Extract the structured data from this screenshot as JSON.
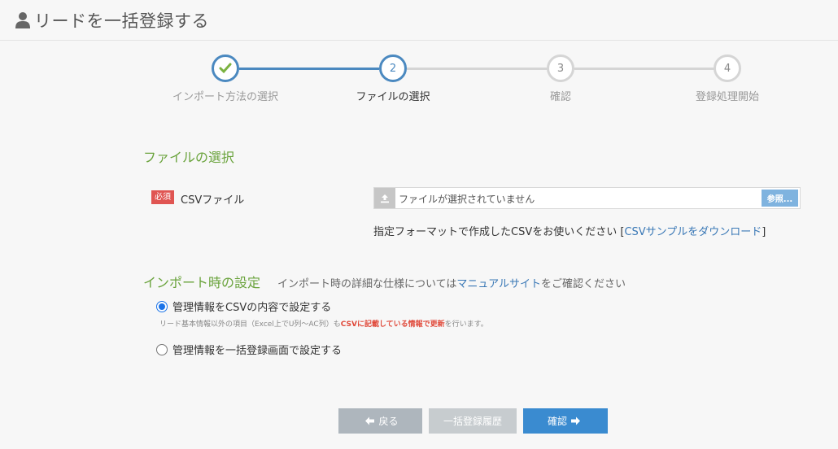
{
  "header": {
    "title": "リードを一括登録する",
    "icon": "user-icon"
  },
  "stepper": {
    "steps": [
      {
        "number": "",
        "label": "インポート方法の選択",
        "state": "done"
      },
      {
        "number": "2",
        "label": "ファイルの選択",
        "state": "active"
      },
      {
        "number": "3",
        "label": "確認",
        "state": "pending"
      },
      {
        "number": "4",
        "label": "登録処理開始",
        "state": "pending"
      }
    ]
  },
  "file_section": {
    "title": "ファイルの選択",
    "required_badge": "必須",
    "csv_label": "CSVファイル",
    "file_placeholder": "ファイルが選択されていません",
    "browse_label": "参照...",
    "note_prefix": "指定フォーマットで作成したCSVをお使いください [",
    "note_link": "CSVサンプルをダウンロード",
    "note_suffix": "]"
  },
  "import_section": {
    "title": "インポート時の設定",
    "hint_prefix": "インポート時の詳細な仕様については",
    "hint_link": "マニュアルサイト",
    "hint_suffix": "をご確認ください",
    "options": [
      {
        "label": "管理情報をCSVの内容で設定する",
        "checked": true
      },
      {
        "label": "管理情報を一括登録画面で設定する",
        "checked": false
      }
    ],
    "sub_note_prefix": "リード基本情報以外の項目（Excel上でU列〜AC列）も",
    "sub_note_highlight": "CSVに記載している情報で更新",
    "sub_note_suffix": "を行います。"
  },
  "buttons": {
    "back": "戻る",
    "history": "一括登録履歴",
    "confirm": "確認"
  },
  "colors": {
    "accent": "#4b89c0",
    "section_title": "#6aa33c",
    "required": "#e05552",
    "primary_button": "#3a8bd0"
  }
}
